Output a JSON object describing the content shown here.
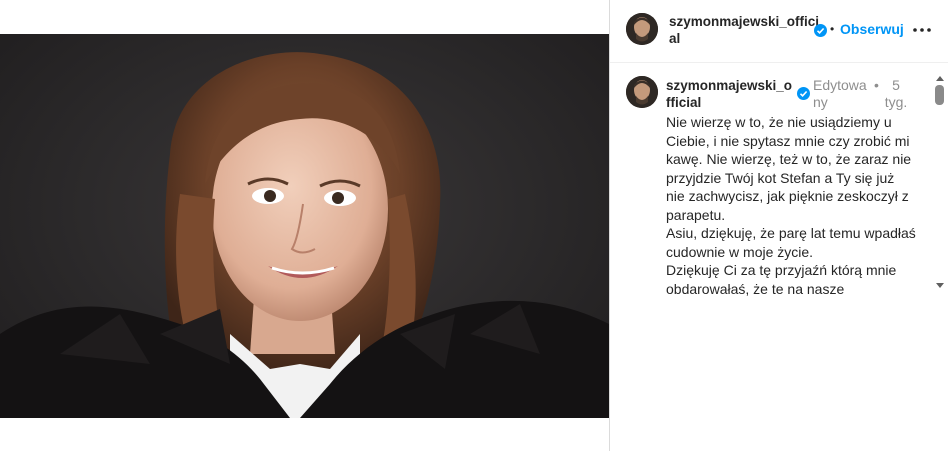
{
  "post": {
    "author_username": "szymonmajewski_official",
    "follow_label": "Obserwuj",
    "separator_dot": "•",
    "caption": {
      "username": "szymonmajewski_official",
      "edited_label": "Edytowany",
      "timeago": "5 tyg.",
      "text": "Nie wierzę w to, że nie usiądziemy u Ciebie, i nie spytasz mnie czy zrobić mi kawę. Nie wierzę, też w to, że zaraz nie przyjdzie Twój kot Stefan a Ty się już nie zachwycisz, jak pięknie zeskoczył z parapetu.\nAsiu, dziękuję, że parę lat temu wpadłaś cudownie w moje życie.\nDziękuję Ci za tę przyjaźń którą mnie obdarowałaś, że te na nasze"
    }
  },
  "icons": {
    "verified": "verified-badge-icon",
    "more": "more-options-icon",
    "scroll_up": "scroll-up-arrow-icon",
    "scroll_down": "scroll-down-arrow-icon"
  },
  "colors": {
    "accent": "#0095f6",
    "text": "#262626",
    "muted": "#8e8e8e",
    "border": "#dbdbdb"
  }
}
